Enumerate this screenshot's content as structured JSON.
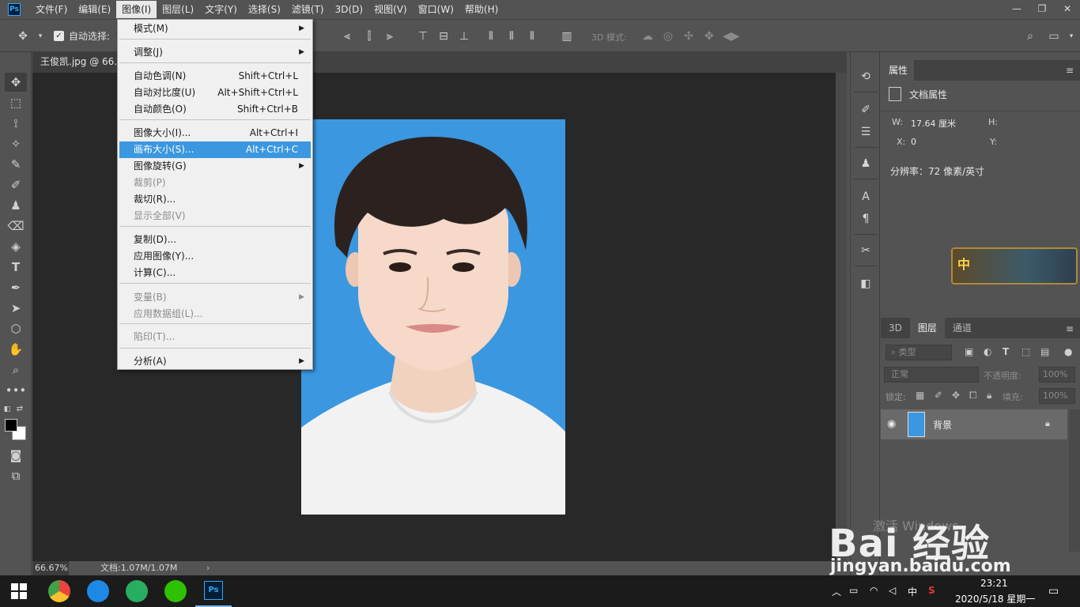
{
  "menubar": {
    "app_icon": "Ps",
    "items": [
      "文件(F)",
      "编辑(E)",
      "图像(I)",
      "图层(L)",
      "文字(Y)",
      "选择(S)",
      "滤镜(T)",
      "3D(D)",
      "视图(V)",
      "窗口(W)",
      "帮助(H)"
    ],
    "active_index": 2
  },
  "window_controls": {
    "minimize": "—",
    "restore": "❐",
    "close": "✕"
  },
  "options": {
    "auto_select_label": "自动选择:",
    "mode_3d_label": "3D 模式:"
  },
  "document": {
    "tab_title": "王俊凯.jpg @ 66.7"
  },
  "status": {
    "zoom": "66.67%",
    "doc_size": "文档:1.07M/1.07M",
    "arrow": "›"
  },
  "image_menu": {
    "items": [
      {
        "label": "模式(M)",
        "shortcut": "",
        "submenu": true,
        "disabled": false
      },
      {
        "label": "调整(J)",
        "shortcut": "",
        "submenu": true,
        "disabled": false
      },
      {
        "label": "自动色调(N)",
        "shortcut": "Shift+Ctrl+L",
        "submenu": false,
        "disabled": false
      },
      {
        "label": "自动对比度(U)",
        "shortcut": "Alt+Shift+Ctrl+L",
        "submenu": false,
        "disabled": false
      },
      {
        "label": "自动颜色(O)",
        "shortcut": "Shift+Ctrl+B",
        "submenu": false,
        "disabled": false
      },
      {
        "label": "图像大小(I)...",
        "shortcut": "Alt+Ctrl+I",
        "submenu": false,
        "disabled": false
      },
      {
        "label": "画布大小(S)...",
        "shortcut": "Alt+Ctrl+C",
        "submenu": false,
        "disabled": false,
        "highlighted": true
      },
      {
        "label": "图像旋转(G)",
        "shortcut": "",
        "submenu": true,
        "disabled": false
      },
      {
        "label": "裁剪(P)",
        "shortcut": "",
        "submenu": false,
        "disabled": true
      },
      {
        "label": "裁切(R)...",
        "shortcut": "",
        "submenu": false,
        "disabled": false
      },
      {
        "label": "显示全部(V)",
        "shortcut": "",
        "submenu": false,
        "disabled": true
      },
      {
        "label": "复制(D)...",
        "shortcut": "",
        "submenu": false,
        "disabled": false
      },
      {
        "label": "应用图像(Y)...",
        "shortcut": "",
        "submenu": false,
        "disabled": false
      },
      {
        "label": "计算(C)...",
        "shortcut": "",
        "submenu": false,
        "disabled": false
      },
      {
        "label": "变量(B)",
        "shortcut": "",
        "submenu": true,
        "disabled": true
      },
      {
        "label": "应用数据组(L)...",
        "shortcut": "",
        "submenu": false,
        "disabled": true
      },
      {
        "label": "陷印(T)...",
        "shortcut": "",
        "submenu": false,
        "disabled": true
      },
      {
        "label": "分析(A)",
        "shortcut": "",
        "submenu": true,
        "disabled": false
      }
    ]
  },
  "properties": {
    "tab": "属性",
    "section": "文档属性",
    "w_label": "W:",
    "w_value": "17.64 厘米",
    "h_label": "H:",
    "x_label": "X:",
    "x_value": "0",
    "y_label": "Y:",
    "resolution": "分辨率：72 像素/英寸",
    "menu_icon": "≡"
  },
  "game_badge": {
    "text": "中"
  },
  "layers": {
    "tabs": [
      "3D",
      "图层",
      "通道"
    ],
    "active_tab": 1,
    "filter_placeholder": "⌕ 类型",
    "blend_mode": "正常",
    "opacity_label": "不透明度:",
    "opacity_value": "100%",
    "lock_label": "锁定:",
    "fill_label": "填充:",
    "fill_value": "100%",
    "layer_name": "背景",
    "menu_icon": "≡"
  },
  "watermark": {
    "logo": "Bai 经验",
    "activate": "激活 Windows",
    "url": "jingyan.baidu.com"
  },
  "taskbar": {
    "ps_label": "Ps",
    "time": "23:21",
    "date": "2020/5/18 星期一",
    "ime": "中",
    "colors": {
      "chrome": "#e8453c",
      "kugou": "#1e88e5",
      "iqiyi": "#27ae60",
      "wechat": "#2dc100"
    }
  }
}
